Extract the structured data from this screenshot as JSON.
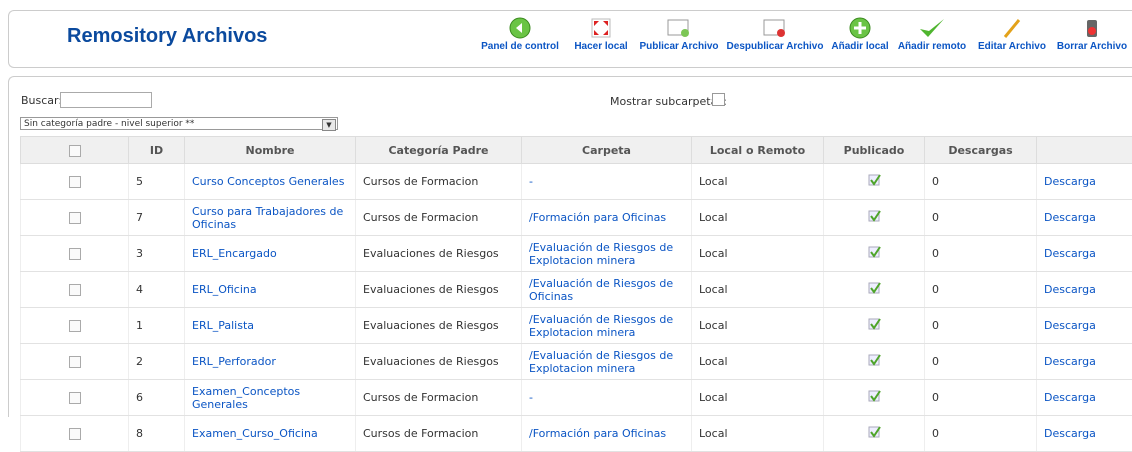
{
  "header": {
    "title": "Remository Archivos"
  },
  "toolbar": [
    {
      "id": "panel",
      "label": "Panel de control",
      "icon": "arrow-left-icon"
    },
    {
      "id": "local",
      "label": "Hacer local",
      "icon": "move-icon"
    },
    {
      "id": "publicar",
      "label": "Publicar Archivo",
      "icon": "publish-icon"
    },
    {
      "id": "despublicar",
      "label": "Despublicar Archivo",
      "icon": "unpublish-icon"
    },
    {
      "id": "anadir-local",
      "label": "Añadir local",
      "icon": "add-icon"
    },
    {
      "id": "anadir-remoto",
      "label": "Añadir remoto",
      "icon": "checkmark-icon"
    },
    {
      "id": "editar",
      "label": "Editar Archivo",
      "icon": "pencil-icon"
    },
    {
      "id": "borrar",
      "label": "Borrar Archivo",
      "icon": "trash-icon"
    }
  ],
  "filters": {
    "search_label": "Buscar:",
    "search_value": "",
    "subfolders_label": "Mostrar subcarpetas:",
    "category_select": "Sin categoría padre - nivel superior **"
  },
  "table": {
    "headers": [
      "ID",
      "Nombre",
      "Categoría Padre",
      "Carpeta",
      "Local o Remoto",
      "Publicado",
      "Descargas",
      ""
    ],
    "rows": [
      {
        "id": "5",
        "nombre": "Curso Conceptos Generales",
        "categoria": "Cursos de Formacion",
        "carpeta": "-",
        "tipo": "Local",
        "descargas": "0",
        "accion": "Descarga"
      },
      {
        "id": "7",
        "nombre": "Curso para Trabajadores de Oficinas",
        "categoria": "Cursos de Formacion",
        "carpeta": "/Formación para Oficinas",
        "tipo": "Local",
        "descargas": "0",
        "accion": "Descarga"
      },
      {
        "id": "3",
        "nombre": "ERL_Encargado",
        "categoria": "Evaluaciones de Riesgos",
        "carpeta": "/Evaluación de Riesgos de Explotacion minera",
        "tipo": "Local",
        "descargas": "0",
        "accion": "Descarga"
      },
      {
        "id": "4",
        "nombre": "ERL_Oficina",
        "categoria": "Evaluaciones de Riesgos",
        "carpeta": "/Evaluación de Riesgos de Oficinas",
        "tipo": "Local",
        "descargas": "0",
        "accion": "Descarga"
      },
      {
        "id": "1",
        "nombre": "ERL_Palista",
        "categoria": "Evaluaciones de Riesgos",
        "carpeta": "/Evaluación de Riesgos de Explotacion minera",
        "tipo": "Local",
        "descargas": "0",
        "accion": "Descarga"
      },
      {
        "id": "2",
        "nombre": "ERL_Perforador",
        "categoria": "Evaluaciones de Riesgos",
        "carpeta": "/Evaluación de Riesgos de Explotacion minera",
        "tipo": "Local",
        "descargas": "0",
        "accion": "Descarga"
      },
      {
        "id": "6",
        "nombre": "Examen_Conceptos Generales",
        "categoria": "Cursos de Formacion",
        "carpeta": "-",
        "tipo": "Local",
        "descargas": "0",
        "accion": "Descarga"
      },
      {
        "id": "8",
        "nombre": "Examen_Curso_Oficina",
        "categoria": "Cursos de Formacion",
        "carpeta": "/Formación para Oficinas",
        "tipo": "Local",
        "descargas": "0",
        "accion": "Descarga"
      }
    ]
  }
}
